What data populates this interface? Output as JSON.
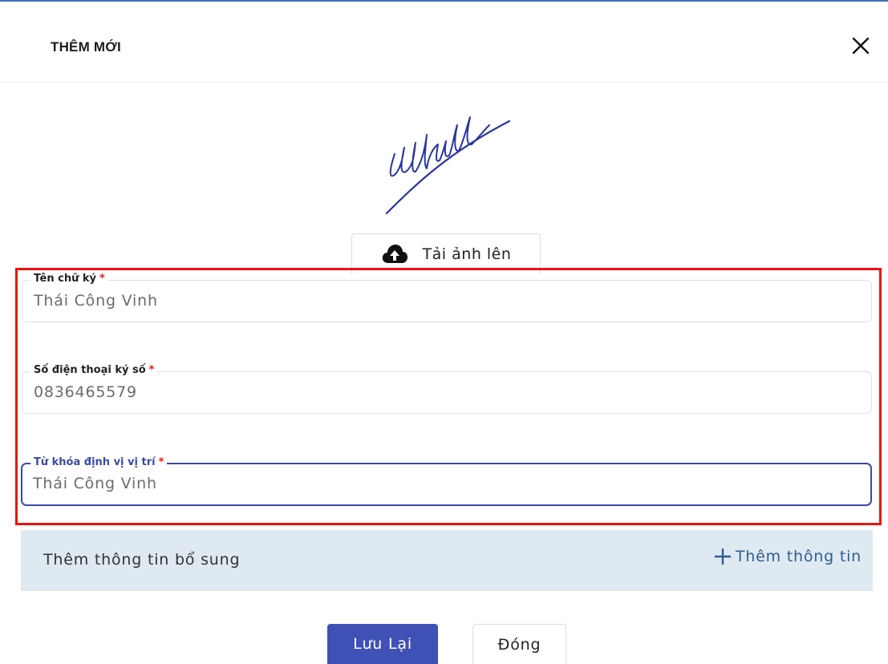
{
  "dialog": {
    "title": "THÊM MỚI",
    "close_icon": "close-icon"
  },
  "signature": {
    "image": "handwritten-signature"
  },
  "upload": {
    "icon": "cloud-upload-icon",
    "label": "Tải ảnh lên"
  },
  "form": {
    "name": {
      "label": "Tên chữ ký",
      "required_mark": "*",
      "value": "Thái Công Vinh"
    },
    "phone": {
      "label": "Số điện thoại ký số",
      "required_mark": "*",
      "value": "0836465579"
    },
    "keyword": {
      "label": "Từ khóa định vị vị trí",
      "required_mark": "*",
      "value": "Thái Công Vinh"
    }
  },
  "extra_info": {
    "text": "Thêm thông tin bổ sung",
    "add_icon": "plus-icon",
    "add_label": "Thêm thông tin"
  },
  "footer": {
    "save_label": "Lưu Lại",
    "close_label": "Đóng"
  },
  "colors": {
    "primary": "#3f51b5",
    "highlight": "#ee1111",
    "panel": "#dfe9f2",
    "link": "#2f5d8e",
    "required": "#e21a1a"
  }
}
